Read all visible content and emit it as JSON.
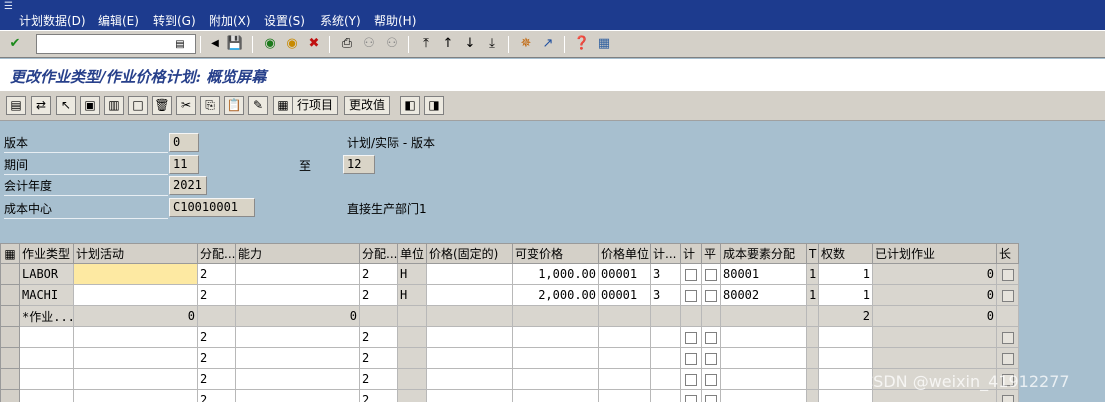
{
  "menu": [
    "计划数据(D)",
    "编辑(E)",
    "转到(G)",
    "附加(X)",
    "设置(S)",
    "系统(Y)",
    "帮助(H)"
  ],
  "toolbar": {
    "command_value": "",
    "icons": [
      "check-icon",
      "back-icon",
      "save-icon",
      "nav-back-icon",
      "exit-icon",
      "cancel-icon",
      "print-icon",
      "find-icon",
      "find-next-icon",
      "first-page-icon",
      "prev-page-icon",
      "next-page-icon",
      "last-page-icon",
      "create-session-icon",
      "shortcut-icon",
      "help-icon",
      "layout-icon"
    ]
  },
  "title": "更改作业类型/作业价格计划: 概览屏幕",
  "app_toolbar": {
    "line_items_label": "行项目",
    "change_values_label": "更改值"
  },
  "header": {
    "version_label": "版本",
    "version_value": "0",
    "version_text": "计划/实际 - 版本",
    "period_label": "期间",
    "period_from": "11",
    "period_to_label": "至",
    "period_to": "12",
    "year_label": "会计年度",
    "year_value": "2021",
    "cost_center_label": "成本中心",
    "cost_center_value": "C10010001",
    "cost_center_text": "直接生产部门1"
  },
  "grid": {
    "columns": [
      "作业类型",
      "计划活动",
      "分配...",
      "能力",
      "分配...",
      "单位",
      "价格(固定的)",
      "可变价格",
      "价格单位",
      "计...",
      "计",
      "平",
      "成本要素分配",
      "T",
      "权数",
      "已计划作业",
      "长"
    ],
    "rows": [
      {
        "activity_type": "LABOR",
        "plan_activity": "",
        "dist1": "2",
        "capacity": "",
        "dist2": "2",
        "unit": "H",
        "fixed_price": "",
        "variable_price": "1,000.00",
        "price_unit": "00001",
        "calc": "3",
        "cost_element": "80001",
        "t": "1",
        "weight": "1",
        "planned_activity": "0"
      },
      {
        "activity_type": "MACHI",
        "plan_activity": "",
        "dist1": "2",
        "capacity": "",
        "dist2": "2",
        "unit": "H",
        "fixed_price": "",
        "variable_price": "2,000.00",
        "price_unit": "00001",
        "calc": "3",
        "cost_element": "80002",
        "t": "1",
        "weight": "1",
        "planned_activity": "0"
      }
    ],
    "total_row": {
      "label": "*作业...",
      "plan_activity": "0",
      "capacity": "0",
      "weight": "2",
      "planned_activity": "0"
    },
    "empty_dist": "2"
  },
  "watermark": "CSDN @weixin_41912277"
}
